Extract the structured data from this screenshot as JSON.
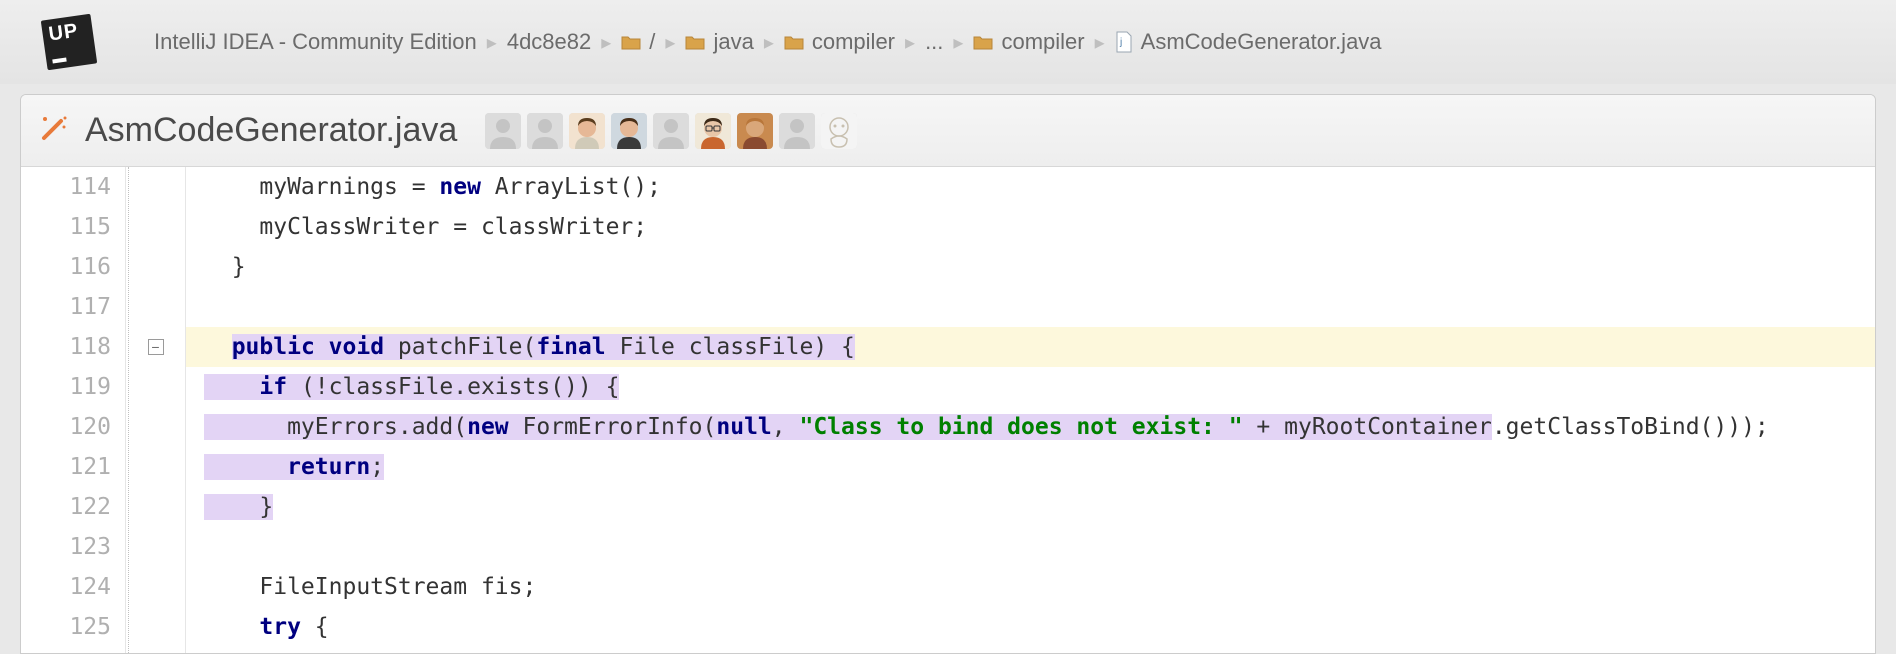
{
  "breadcrumb": {
    "app": "IntelliJ IDEA - Community Edition",
    "commit": "4dc8e82",
    "root": "/",
    "java": "java",
    "compiler1": "compiler",
    "ellipsis": "...",
    "compiler2": "compiler",
    "file": "AsmCodeGenerator.java"
  },
  "file_header": {
    "title": "AsmCodeGenerator.java"
  },
  "avatars": [
    {
      "name": "contributor-1",
      "type": "placeholder"
    },
    {
      "name": "contributor-2",
      "type": "placeholder"
    },
    {
      "name": "contributor-3",
      "type": "photo",
      "bg": "#f2e2cf",
      "shirt": "#d0cab8",
      "skin": "#e6b896",
      "hair": "#5a3d1e"
    },
    {
      "name": "contributor-4",
      "type": "photo",
      "bg": "#cfd8df",
      "shirt": "#3a3a3a",
      "skin": "#e6b896",
      "hair": "#4a2f18"
    },
    {
      "name": "contributor-5",
      "type": "placeholder"
    },
    {
      "name": "contributor-6",
      "type": "photo",
      "bg": "#f0e8d8",
      "shirt": "#c9662e",
      "skin": "#e8c6a8",
      "hair": "#3d2a18",
      "glasses": true
    },
    {
      "name": "contributor-7",
      "type": "photo",
      "bg": "#c98a4f",
      "shirt": "#8a4a30",
      "skin": "#d9a77a",
      "hair": "#b8763a"
    },
    {
      "name": "contributor-8",
      "type": "placeholder"
    },
    {
      "name": "contributor-9",
      "type": "identicon"
    }
  ],
  "code": {
    "lines": [
      {
        "n": 114,
        "text": "    myWarnings = ",
        "kw1": "new",
        "text2": " ArrayList();"
      },
      {
        "n": 115,
        "text": "    myClassWriter = classWriter;"
      },
      {
        "n": 116,
        "text": "  }"
      },
      {
        "n": 117,
        "text": ""
      },
      {
        "n": 118,
        "fold": true,
        "hl_y": true,
        "hl_p_sig": true,
        "pre": "  ",
        "kw_public": "public",
        "sp1": " ",
        "kw_void": "void",
        "sp2": " ",
        "method": "patchFile(",
        "kw_final": "final",
        "sp3": " ",
        "rest": "File classFile) {"
      },
      {
        "n": 119,
        "hl_p": true,
        "pre": "    ",
        "kw_if": "if",
        "rest": " (!classFile.exists()) {"
      },
      {
        "n": 120,
        "hl_p": true,
        "pre": "      ",
        "text": "myErrors.add(",
        "kw_new": "new",
        "text2": " FormErrorInfo(",
        "kw_null": "null",
        "text3": ", ",
        "str": "\"Class to bind does not exist: \"",
        "text4": " + myRootContainer",
        "tail": ".getClassToBind()));"
      },
      {
        "n": 121,
        "hl_p": true,
        "pre": "      ",
        "kw_return": "return",
        "rest": ";"
      },
      {
        "n": 122,
        "hl_p": true,
        "pre": "    ",
        "text": "}"
      },
      {
        "n": 123,
        "text": ""
      },
      {
        "n": 124,
        "text": "    FileInputStream fis;"
      },
      {
        "n": 125,
        "pre": "    ",
        "kw_try": "try",
        "rest": " {"
      }
    ]
  }
}
